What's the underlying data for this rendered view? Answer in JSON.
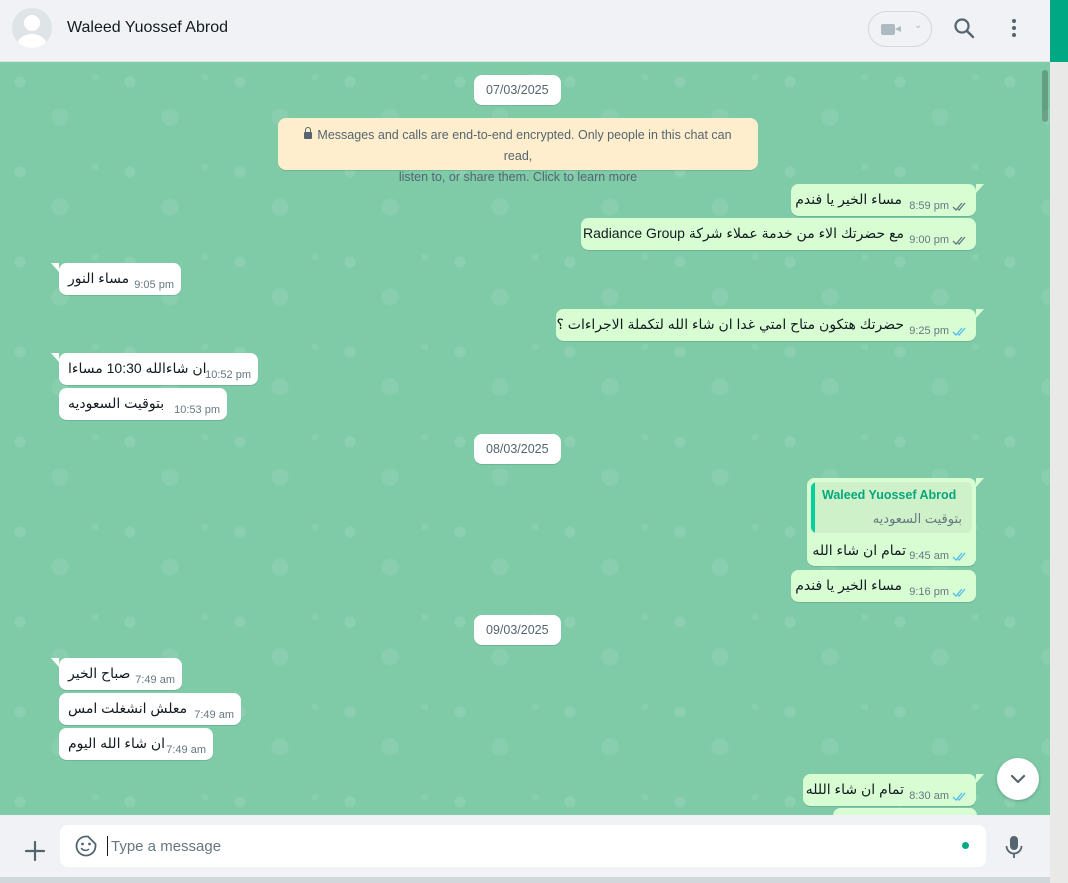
{
  "header": {
    "contact_name": "Waleed Yuossef Abrod",
    "video_icon": "video-camera-icon",
    "search_icon": "search-icon",
    "menu_icon": "kebab-menu-icon"
  },
  "chat": {
    "dates": [
      "07/03/2025",
      "08/03/2025",
      "09/03/2025"
    ],
    "encryption_notice_line1": "Messages and calls are end-to-end encrypted. Only people in this chat can read,",
    "encryption_notice_line2": "listen to, or share them. Click to learn more",
    "messages": [
      {
        "dir": "out",
        "text": "مساء الخير يا فندم",
        "time": "8:59 pm",
        "status": "delivered"
      },
      {
        "dir": "out",
        "text": "مع حضرتك الاء من خدمة عملاء شركة Radiance Group",
        "time": "9:00 pm",
        "status": "delivered"
      },
      {
        "dir": "in",
        "text": "مساء النور",
        "time": "9:05 pm"
      },
      {
        "dir": "out",
        "text": "حضرتك هتكون متاح امتي غدا ان شاء الله لتكملة الاجراءات ؟",
        "time": "9:25 pm",
        "status": "read"
      },
      {
        "dir": "in",
        "text": "ان شاءالله 10:30 مساءا",
        "time": "10:52 pm"
      },
      {
        "dir": "in",
        "text": "بتوقيت السعوديه",
        "time": "10:53 pm"
      },
      {
        "dir": "out",
        "text": "تمام ان شاء الله",
        "time": "9:45 am",
        "status": "read",
        "quote_author": "Waleed Yuossef Abrod",
        "quote_text": "بتوقيت السعوديه"
      },
      {
        "dir": "out",
        "text": "مساء الخير يا فندم",
        "time": "9:16 pm",
        "status": "read"
      },
      {
        "dir": "in",
        "text": "صباح الخير",
        "time": "7:49 am"
      },
      {
        "dir": "in",
        "text": "معلش انشغلت امس",
        "time": "7:49 am"
      },
      {
        "dir": "in",
        "text": "ان شاء الله اليوم",
        "time": "7:49 am"
      },
      {
        "dir": "out",
        "text": "تمام ان شاء اللله",
        "time": "8:30 am",
        "status": "read"
      }
    ]
  },
  "composer": {
    "placeholder": "Type a message",
    "attach_icon": "plus-icon",
    "emoji_icon": "sticker-emoji-icon",
    "mic_icon": "microphone-icon"
  },
  "colors": {
    "accent": "#00a884",
    "chat_bg": "#7fcba8",
    "outgoing_bubble": "#d9fdd3",
    "incoming_bubble": "#ffffff",
    "read_ticks": "#53bdeb",
    "delivered_ticks": "#667781",
    "notice_bg": "#ffeecd"
  }
}
